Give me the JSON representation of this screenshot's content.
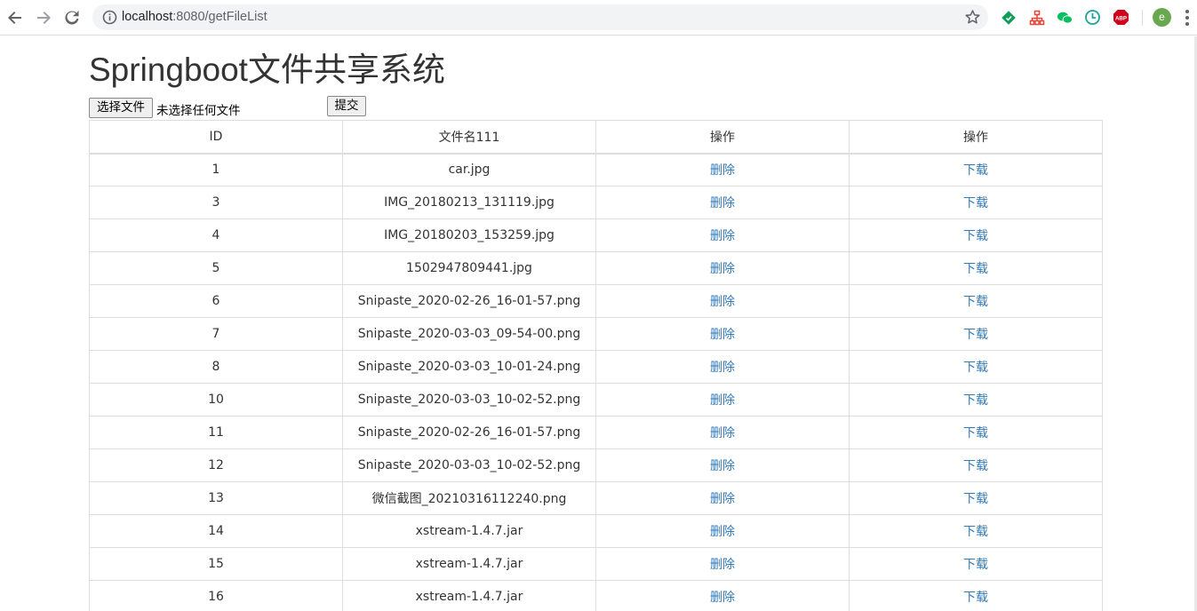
{
  "browser": {
    "url_host": "localhost",
    "url_rest": ":8080/getFileList",
    "avatar_letter": "e",
    "adblock_label": "ABP",
    "colors": {
      "ext_diamond": "#0f9d58",
      "ext_tree": "#ea4335",
      "ext_wechat": "#07c160",
      "ext_clock": "#1aa39a",
      "ext_adblock": "#d0021b",
      "avatar": "#6aa84f"
    }
  },
  "page": {
    "title": "Springboot文件共享系统",
    "upload": {
      "choose_label": "选择文件",
      "file_status": "未选择任何文件",
      "submit_label": "提交"
    },
    "table": {
      "headers": [
        "ID",
        "文件名111",
        "操作",
        "操作"
      ],
      "rows": [
        {
          "id": "1",
          "name": "car.jpg",
          "delete": "删除",
          "download": "下载"
        },
        {
          "id": "3",
          "name": "IMG_20180213_131119.jpg",
          "delete": "删除",
          "download": "下载"
        },
        {
          "id": "4",
          "name": "IMG_20180203_153259.jpg",
          "delete": "删除",
          "download": "下载"
        },
        {
          "id": "5",
          "name": "1502947809441.jpg",
          "delete": "删除",
          "download": "下载"
        },
        {
          "id": "6",
          "name": "Snipaste_2020-02-26_16-01-57.png",
          "delete": "删除",
          "download": "下载"
        },
        {
          "id": "7",
          "name": "Snipaste_2020-03-03_09-54-00.png",
          "delete": "删除",
          "download": "下载"
        },
        {
          "id": "8",
          "name": "Snipaste_2020-03-03_10-01-24.png",
          "delete": "删除",
          "download": "下载"
        },
        {
          "id": "10",
          "name": "Snipaste_2020-03-03_10-02-52.png",
          "delete": "删除",
          "download": "下载"
        },
        {
          "id": "11",
          "name": "Snipaste_2020-02-26_16-01-57.png",
          "delete": "删除",
          "download": "下载"
        },
        {
          "id": "12",
          "name": "Snipaste_2020-03-03_10-02-52.png",
          "delete": "删除",
          "download": "下载"
        },
        {
          "id": "13",
          "name": "微信截图_20210316112240.png",
          "delete": "删除",
          "download": "下载"
        },
        {
          "id": "14",
          "name": "xstream-1.4.7.jar",
          "delete": "删除",
          "download": "下载"
        },
        {
          "id": "15",
          "name": "xstream-1.4.7.jar",
          "delete": "删除",
          "download": "下载"
        },
        {
          "id": "16",
          "name": "xstream-1.4.7.jar",
          "delete": "删除",
          "download": "下载"
        }
      ]
    }
  }
}
